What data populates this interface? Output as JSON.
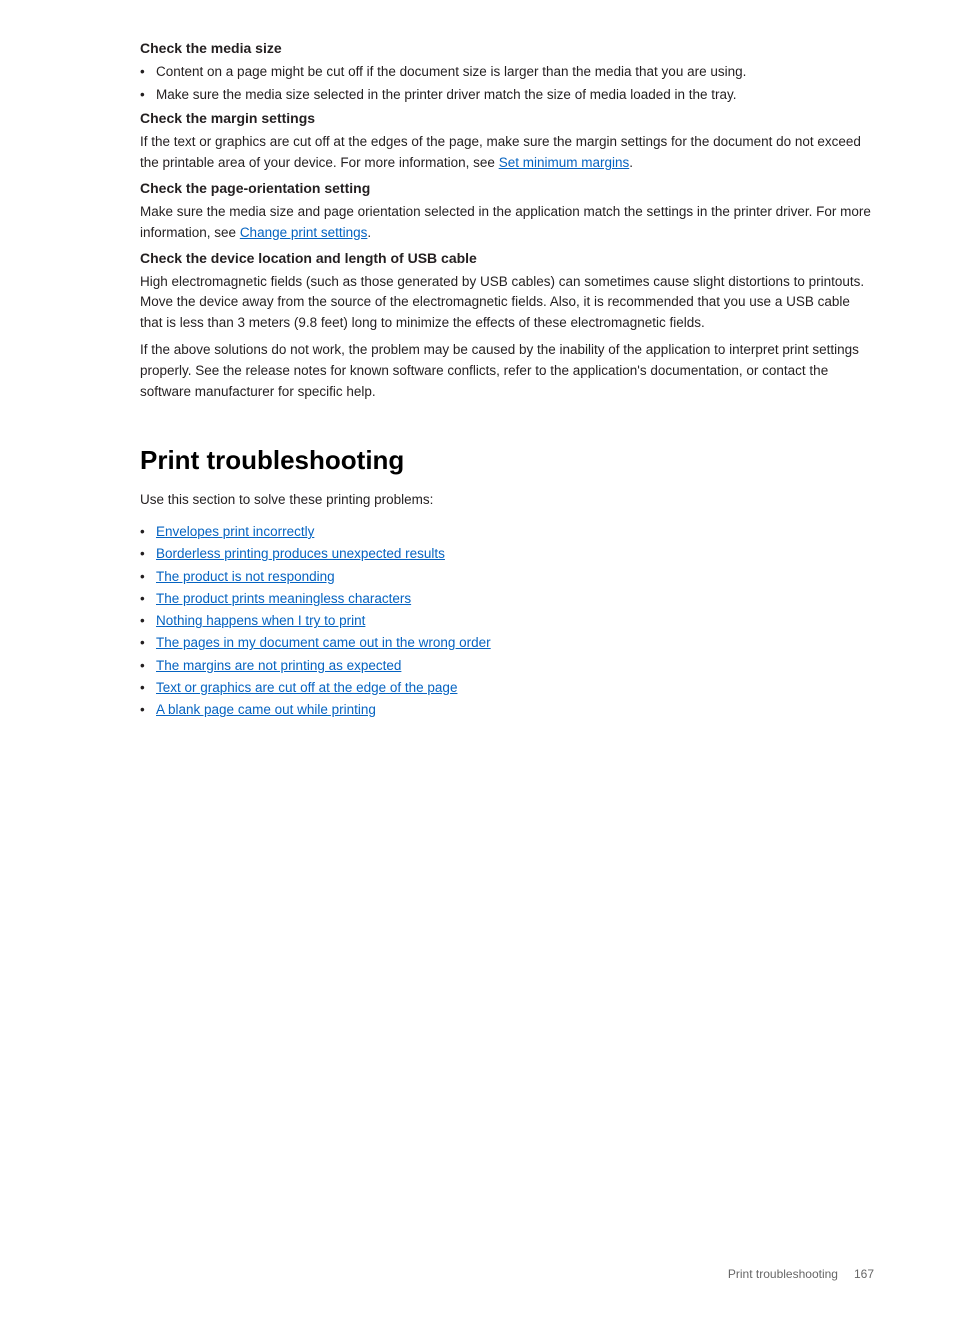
{
  "sections": [
    {
      "id": "check-media-size",
      "heading": "Check the media size",
      "bullets": [
        "Content on a page might be cut off if the document size is larger than the media that you are using.",
        "Make sure the media size selected in the printer driver match the size of media loaded in the tray."
      ]
    },
    {
      "id": "check-margin-settings",
      "heading": "Check the margin settings",
      "body": "If the text or graphics are cut off at the edges of the page, make sure the margin settings for the document do not exceed the printable area of your device. For more information, see ",
      "link_text": "Set minimum margins",
      "body_after": "."
    },
    {
      "id": "check-page-orientation",
      "heading": "Check the page-orientation setting",
      "body": "Make sure the media size and page orientation selected in the application match the settings in the printer driver. For more information, see ",
      "link_text": "Change print settings",
      "body_after": "."
    },
    {
      "id": "check-device-location",
      "heading": "Check the device location and length of USB cable",
      "body1": "High electromagnetic fields (such as those generated by USB cables) can sometimes cause slight distortions to printouts. Move the device away from the source of the electromagnetic fields. Also, it is recommended that you use a USB cable that is less than 3 meters (9.8 feet) long to minimize the effects of these electromagnetic fields.",
      "body2": "If the above solutions do not work, the problem may be caused by the inability of the application to interpret print settings properly. See the release notes for known software conflicts, refer to the application's documentation, or contact the software manufacturer for specific help."
    }
  ],
  "main_section": {
    "heading": "Print troubleshooting",
    "intro": "Use this section to solve these printing problems:",
    "links": [
      "Envelopes print incorrectly",
      "Borderless printing produces unexpected results",
      "The product is not responding",
      "The product prints meaningless characters",
      "Nothing happens when I try to print",
      "The pages in my document came out in the wrong order",
      "The margins are not printing as expected",
      "Text or graphics are cut off at the edge of the page",
      "A blank page came out while printing"
    ]
  },
  "footer": {
    "section": "Print troubleshooting",
    "page": "167"
  }
}
